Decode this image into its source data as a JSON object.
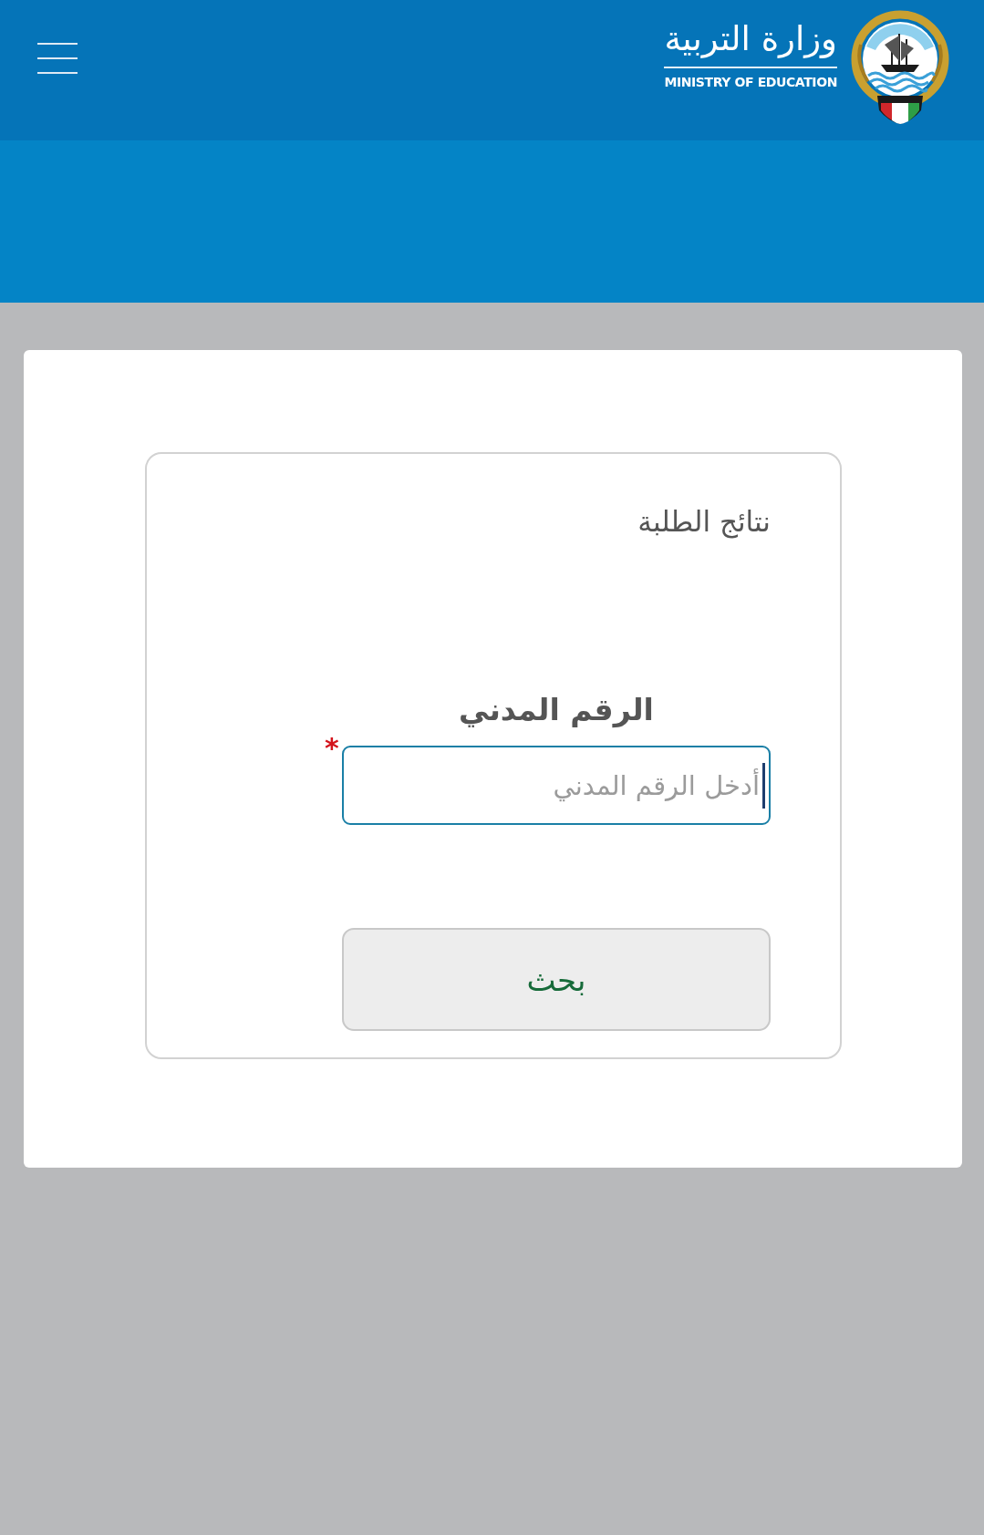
{
  "header": {
    "logo": {
      "arabic": "وزارة التربية",
      "english": "MINISTRY OF EDUCATION"
    }
  },
  "form": {
    "title": "نتائج الطلبة",
    "field": {
      "label": "الرقم المدني",
      "required_mark": "*",
      "placeholder": "أدخل الرقم المدني",
      "focused": true
    },
    "button": "بحث"
  }
}
